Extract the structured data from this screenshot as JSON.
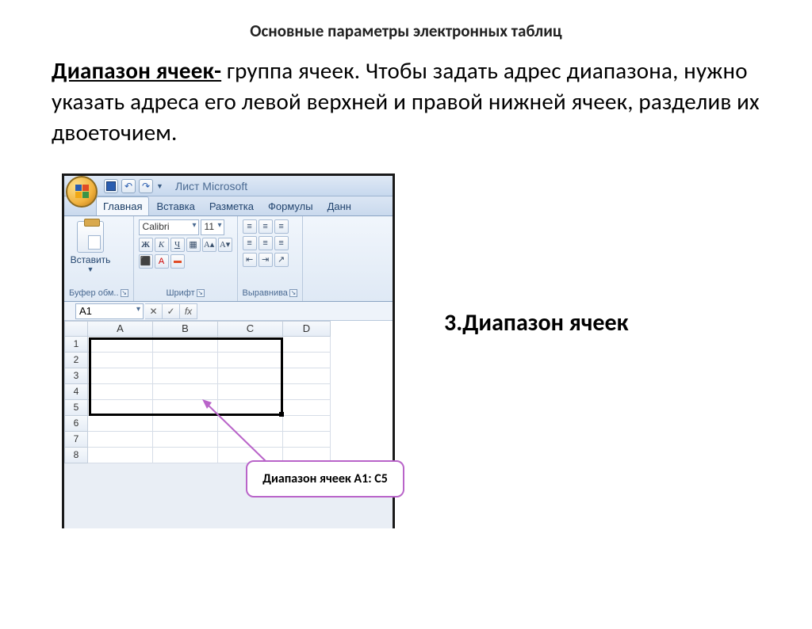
{
  "slide": {
    "title": "Основные параметры электронных таблиц",
    "term": "Диапазон ячеек-",
    "definition": " группа ячеек. Чтобы задать адрес диапазона, нужно указать адреса его левой верхней и правой нижней ячеек,  разделив их двоеточием",
    "heading3": "3.Диапазон ячеек",
    "callout": "Диапазон ячеек A1: C5"
  },
  "excel": {
    "titlebar_caption": "Лист Microsoft",
    "tabs": [
      "Главная",
      "Вставка",
      "Разметка",
      "Формулы",
      "Данн"
    ],
    "active_tab": 0,
    "groups": {
      "clipboard": {
        "paste": "Вставить",
        "label": "Буфер обм.."
      },
      "font": {
        "name": "Calibri",
        "size": "11",
        "bold": "Ж",
        "italic": "К",
        "underline": "Ч",
        "label": "Шрифт"
      },
      "align": {
        "label": "Выравнива"
      }
    },
    "namebox": "A1",
    "fx_label": "fx",
    "columns": [
      "A",
      "B",
      "C",
      "D"
    ],
    "rows": [
      "1",
      "2",
      "3",
      "4",
      "5",
      "6",
      "7",
      "8"
    ]
  },
  "colors": {
    "accent": "#b964c9"
  }
}
